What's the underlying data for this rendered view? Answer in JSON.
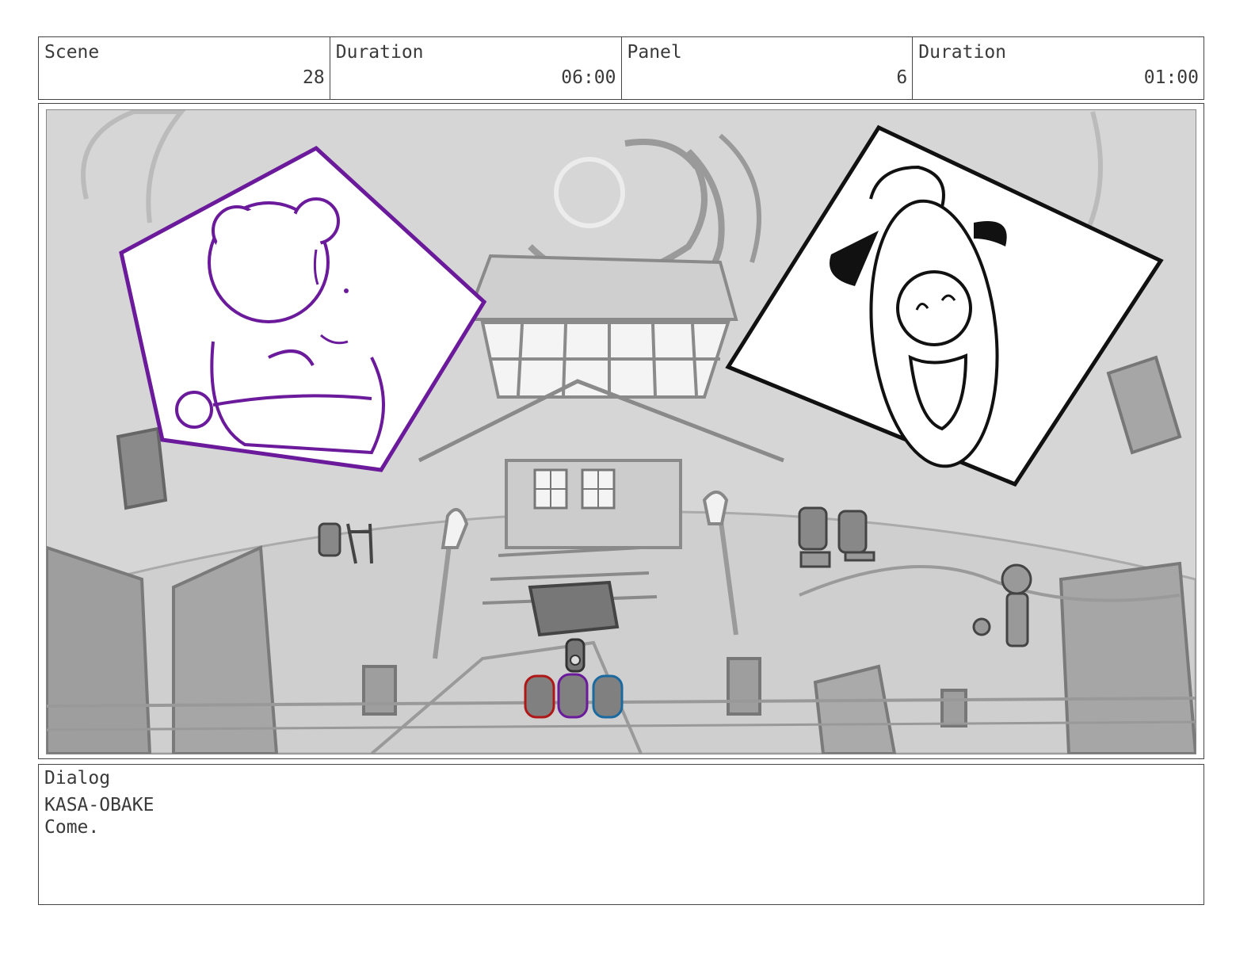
{
  "header": {
    "scene_label": "Scene",
    "scene_value": "28",
    "scene_duration_label": "Duration",
    "scene_duration_value": "06:00",
    "panel_label": "Panel",
    "panel_value": "6",
    "panel_duration_label": "Duration",
    "panel_duration_value": "01:00"
  },
  "dialog": {
    "label": "Dialog",
    "speaker": "KASA-OBAKE",
    "line": "Come."
  },
  "colors": {
    "bear_outline": "#6a1a9a",
    "character_red": "#b01818",
    "character_purple": "#6a1a9a",
    "character_blue": "#1a6aa0",
    "sketch_gray": "#9a9a9a",
    "ground_gray": "#d2d2d2"
  }
}
